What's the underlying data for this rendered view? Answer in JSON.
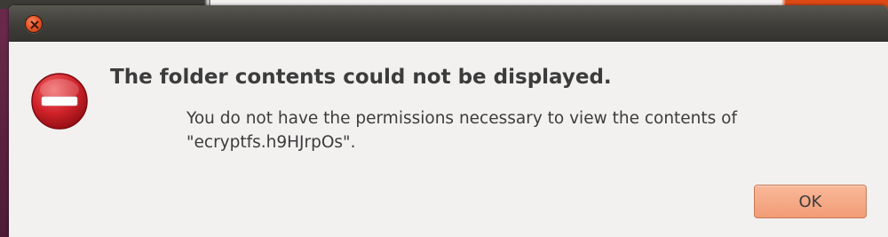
{
  "dialog": {
    "title": "",
    "heading": "The folder contents could not be displayed.",
    "message": "You do not have the permissions necessary to view the contents of \"ecryptfs.h9HJrpOs\".",
    "ok_label": "OK",
    "icon": "error-icon"
  },
  "colors": {
    "titlebar": "#3c3b37",
    "close_button": "#e8572a",
    "dialog_background": "#f2f1f0",
    "ok_button": "#f29c75",
    "error_icon": "#c7161e"
  }
}
